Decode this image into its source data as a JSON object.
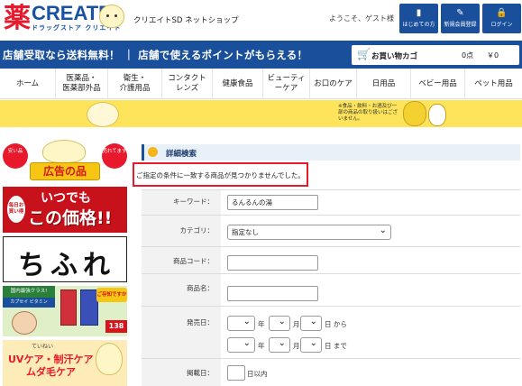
{
  "header": {
    "logo_kanji": "薬",
    "logo_name": "CREATE",
    "logo_sub": "ドラッグストア クリエイト",
    "shop_title": "クリエイトSD ネットショップ",
    "welcome": "ようこそ、ゲスト様",
    "buttons": [
      {
        "label": "はじめての方",
        "icon": "book-icon"
      },
      {
        "label": "新規会員登録",
        "icon": "pencil-icon"
      },
      {
        "label": "ログイン",
        "icon": "lock-icon"
      }
    ]
  },
  "banner": {
    "text": "店舗受取なら送料無料！ ｜ 店舗で使えるポイントがもらえる！",
    "cart_label": "お買い物カゴ",
    "cart_count": "0点",
    "cart_amount": "￥0"
  },
  "nav": {
    "items": [
      "ホーム",
      "医薬品・\n医薬部外品",
      "衛生・\n介護用品",
      "コンタクト\nレンズ",
      "健康食品",
      "ビューティ\nーケア",
      "お口のケア",
      "日用品",
      "ベビー用品",
      "ペット用品"
    ]
  },
  "strip": {
    "note": "※食品・飲料・お酒及び一部の商品の取り扱いはございません。"
  },
  "sidebar": {
    "ad1": {
      "left": "安い品",
      "right": "売れてます",
      "label": "広告の品"
    },
    "ad2": {
      "badge": "毎日お買い得",
      "line1": "いつでも",
      "line2": "この価格!!"
    },
    "ad3": {
      "text": "ちふれ"
    },
    "ad4": {
      "title": "国内最強クラス!",
      "sub": "カプセイ ビタミン",
      "burst": "ご存知ですか",
      "price": "138"
    },
    "ad5": {
      "line1": "ていねい",
      "line2": "UVケア・制汗ケア・",
      "line3": "ムダ毛ケア"
    }
  },
  "main": {
    "section_title": "詳細検索",
    "alert": "ご指定の条件に一致する商品が見つかりませんでした。",
    "fields": {
      "keyword_label": "キーワード：",
      "keyword_value": "るんるんの湯",
      "category_label": "カテゴリ：",
      "category_value": "指定なし",
      "code_label": "商品コード：",
      "name_label": "商品名：",
      "date_label": "発売日：",
      "year": "年",
      "month": "月",
      "day_from": "日 から",
      "day_to": "日 まで",
      "days_label": "掲載日：",
      "days_within": "日以内"
    }
  }
}
